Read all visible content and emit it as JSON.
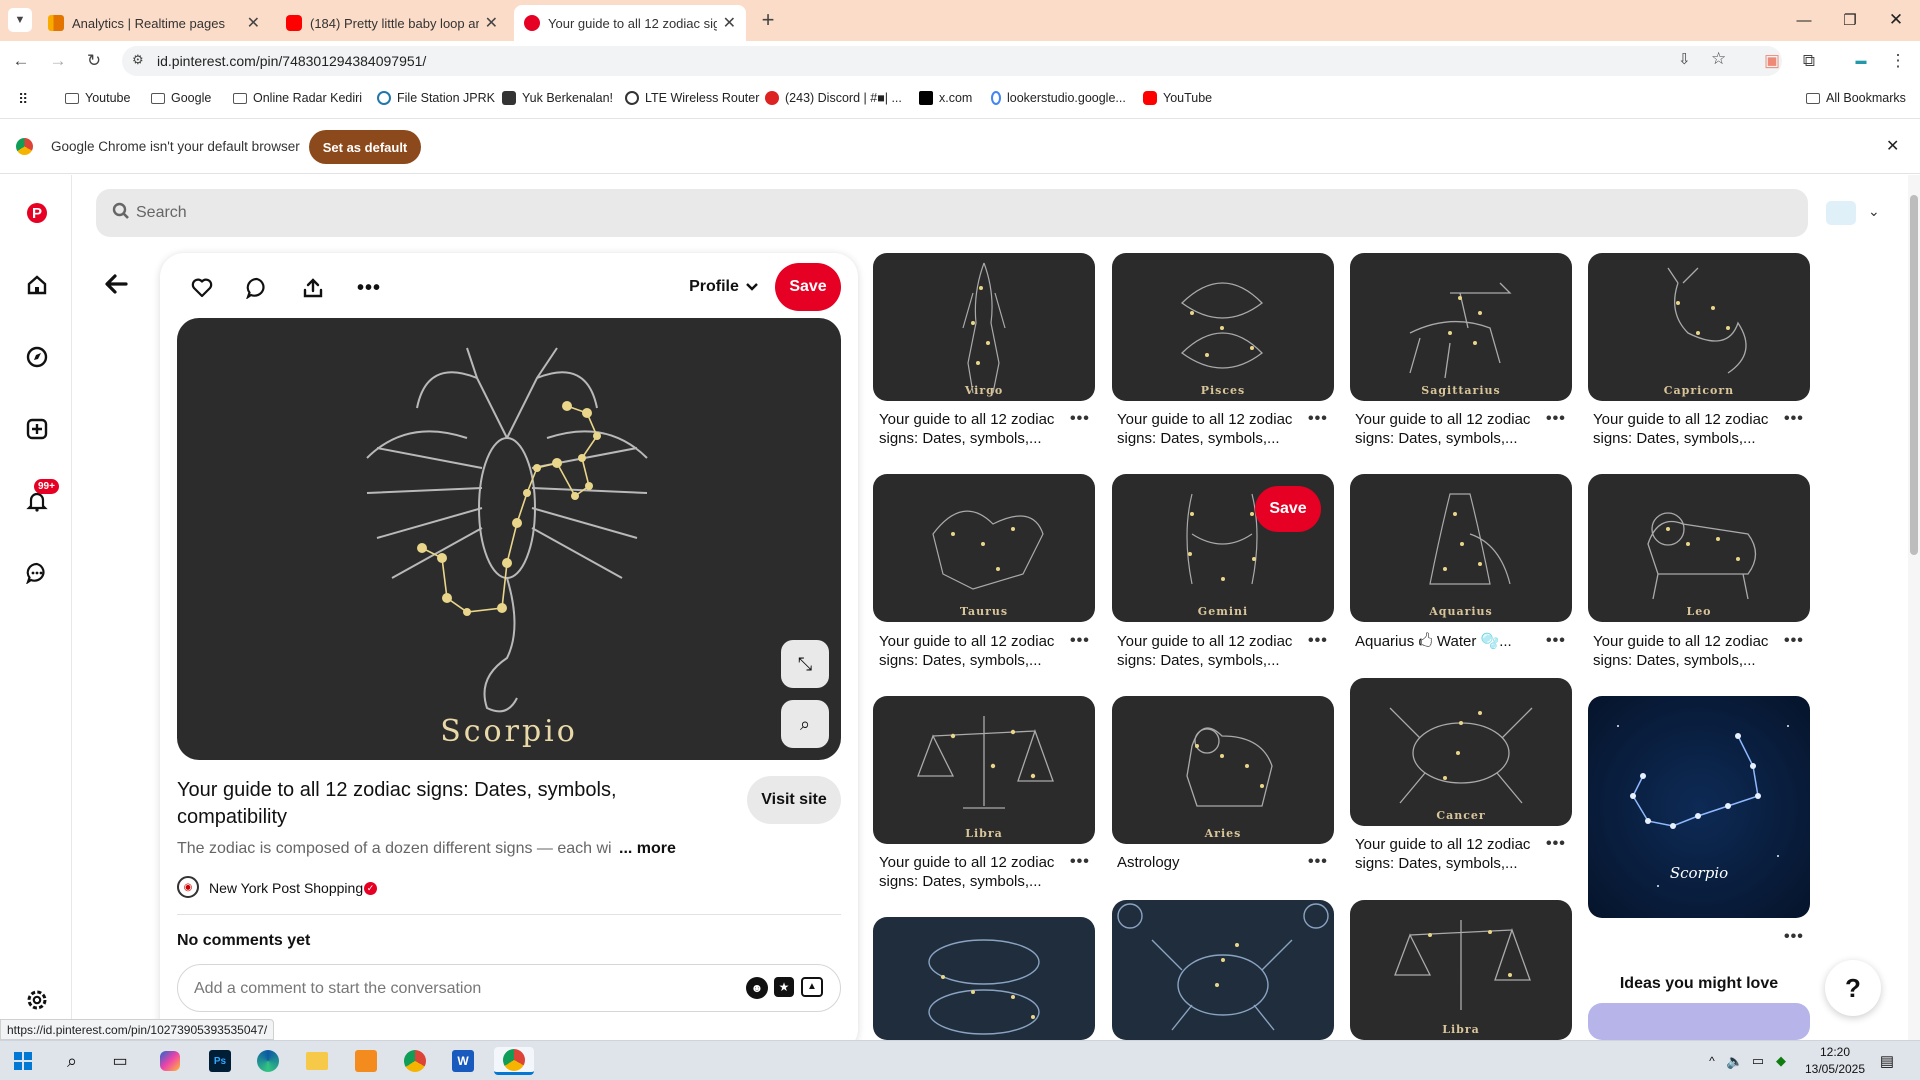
{
  "browser": {
    "tabs": [
      {
        "title": "Analytics | Realtime pages",
        "icon": "analytics-icon"
      },
      {
        "title": "(184) Pretty little baby loop aro",
        "icon": "youtube-icon"
      },
      {
        "title": "Your guide to all 12 zodiac sign",
        "icon": "pinterest-icon"
      }
    ],
    "url": "id.pinterest.com/pin/748301294384097951/",
    "bookmarks": [
      "Youtube",
      "Google",
      "Online Radar Kediri",
      "File Station JPRK",
      "Yuk Berkenalan!",
      "LTE Wireless Router",
      "(243) Discord | #■| ...",
      "x.com",
      "lookerstudio.google...",
      "YouTube"
    ],
    "all_bookmarks": "All Bookmarks",
    "infobar_text": "Google Chrome isn't your default browser",
    "infobar_button": "Set as default",
    "status_url": "https://id.pinterest.com/pin/10273905393535047/"
  },
  "pinterest": {
    "search_placeholder": "Search",
    "notifications_badge": "99+",
    "profile_label": "Profile",
    "save_label": "Save",
    "pin_image_caption": "Scorpio",
    "pin_title": "Your guide to all 12 zodiac signs: Dates, symbols, compatibility",
    "visit_site": "Visit site",
    "description": "The zodiac is composed of a dozen different signs — each wi",
    "more": "... more",
    "source_name": "New York Post Shopping",
    "comments_heading": "No comments yet",
    "comment_placeholder": "Add a comment to start the conversation",
    "ideas_heading": "Ideas you might love",
    "grid": [
      {
        "sign": "Virgo",
        "desc": "Your guide to all 12 zodiac signs: Dates, symbols,..."
      },
      {
        "sign": "Pisces",
        "desc": "Your guide to all 12 zodiac signs: Dates, symbols,..."
      },
      {
        "sign": "Sagittarius",
        "desc": "Your guide to all 12 zodiac signs: Dates, symbols,..."
      },
      {
        "sign": "Capricorn",
        "desc": "Your guide to all 12 zodiac signs: Dates, symbols,..."
      },
      {
        "sign": "Taurus",
        "desc": "Your guide to all 12 zodiac signs: Dates, symbols,..."
      },
      {
        "sign": "Gemini",
        "desc": "Your guide to all 12 zodiac signs: Dates, symbols,..."
      },
      {
        "sign": "Aquarius",
        "desc": "Aquarius 🖒 Water 🫧..."
      },
      {
        "sign": "Leo",
        "desc": "Your guide to all 12 zodiac signs: Dates, symbols,..."
      },
      {
        "sign": "Libra",
        "desc": "Your guide to all 12 zodiac signs: Dates, symbols,..."
      },
      {
        "sign": "Aries",
        "desc": "Astrology"
      },
      {
        "sign": "Cancer",
        "desc": "Your guide to all 12 zodiac signs: Dates, symbols,..."
      },
      {
        "sign": "Scorpio",
        "desc": ""
      },
      {
        "sign": "",
        "desc": ""
      },
      {
        "sign": "",
        "desc": ""
      },
      {
        "sign": "Libra",
        "desc": ""
      }
    ],
    "colors": {
      "brand": "#e60023",
      "tile": "#2b2b2b",
      "constellation": "#e9d68a"
    }
  },
  "taskbar": {
    "time": "12:20",
    "date": "13/05/2025"
  }
}
